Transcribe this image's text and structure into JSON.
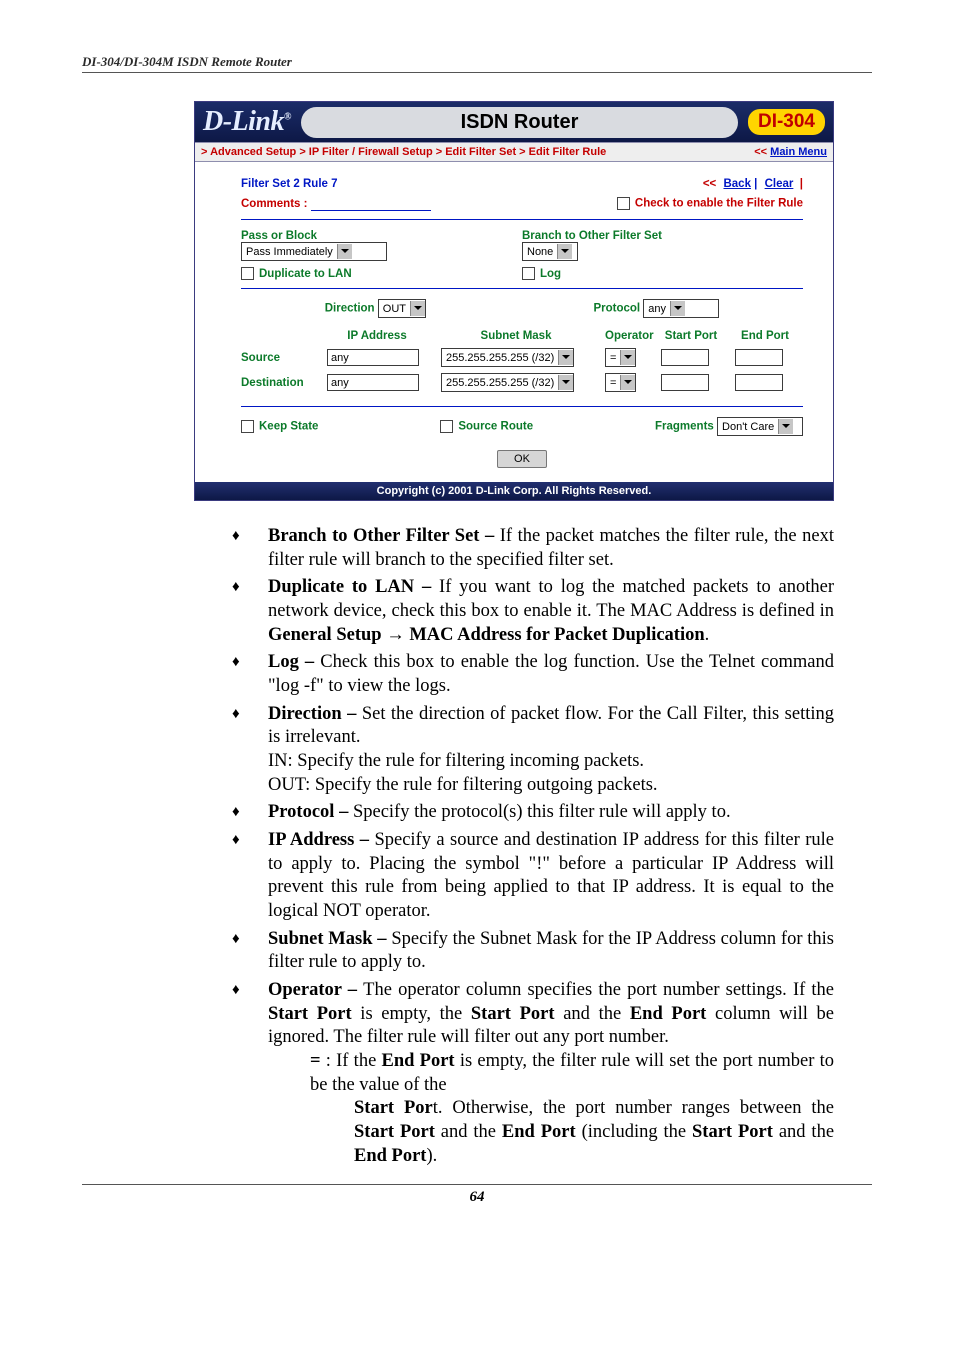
{
  "doc": {
    "header": "DI-304/DI-304M ISDN Remote Router",
    "page_number": "64"
  },
  "shot": {
    "brand": "D-Link",
    "title": "ISDN Router",
    "model": "DI-304",
    "breadcrumb": "> Advanced Setup > IP Filter / Firewall Setup > Edit Filter Set > Edit Filter Rule",
    "main_menu_prefix": "<<",
    "main_menu": "Main Menu",
    "filter_title": "Filter Set 2 Rule 7",
    "back_prefix": "<<",
    "back": "Back",
    "pipe": " | ",
    "clear": "Clear",
    "comments_label": "Comments :",
    "enable_label": "Check to enable the Filter Rule",
    "pass_label": "Pass or Block",
    "pass_value": "Pass Immediately",
    "branch_label": "Branch to Other Filter Set",
    "branch_value": "None",
    "dup_label": "Duplicate to LAN",
    "log_label": "Log",
    "direction_label": "Direction",
    "direction_value": "OUT",
    "protocol_label": "Protocol",
    "protocol_value": "any",
    "col_ip": "IP Address",
    "col_mask": "Subnet Mask",
    "col_op": "Operator",
    "col_start": "Start Port",
    "col_end": "End Port",
    "row_src": "Source",
    "row_dst": "Destination",
    "val_any": "any",
    "val_mask": "255.255.255.255 (/32)",
    "val_op": "=",
    "keep_label": "Keep State",
    "sroute_label": "Source Route",
    "frag_label": "Fragments",
    "frag_value": "Don't Care",
    "ok": "OK",
    "copyright": "Copyright (c) 2001 D-Link Corp. All Rights Reserved."
  },
  "bul": {
    "b1_t": "Branch to Other Filter Set – ",
    "b1_x": "If the packet matches the filter rule, the next filter rule will branch to the specified filter set.",
    "b2_t": "Duplicate to LAN – ",
    "b2_x1": "If you want to log the matched packets to another network device, check this box to enable it. The MAC Address is defined in ",
    "b2_x2": "General Setup",
    "b2_arrow": " → ",
    "b2_x3": "MAC Address for Packet Duplication",
    "b2_x4": ".",
    "b3_t": "Log – ",
    "b3_x": "Check this box to enable the log function. Use the Telnet command \"log -f\" to view the logs.",
    "b4_t": "Direction – ",
    "b4_x": "Set the direction of packet flow. For the Call Filter, this setting is irrelevant.",
    "b4_in": "IN: Specify the rule for filtering incoming packets.",
    "b4_out": "OUT: Specify the rule for filtering outgoing packets.",
    "b5_t": "Protocol – ",
    "b5_x": "Specify the protocol(s) this filter rule will apply to.",
    "b6_t": "IP Address – ",
    "b6_x": "Specify a source and destination IP address for this filter rule to apply to. Placing the symbol \"!\" before a particular IP Address will prevent this rule from being applied to that IP address. It is equal to the logical NOT operator.",
    "b7_t": "Subnet Mask – ",
    "b7_x": "Specify the Subnet Mask for the IP Address column for this filter rule to apply to.",
    "b8_t": "Operator – ",
    "b8_x1": "The operator column specifies the port number settings. If the ",
    "b8_sp": "Start Port",
    "b8_x2": " is empty, the ",
    "b8_x3": " and the ",
    "b8_ep": "End Port",
    "b8_x4": " column will be ignored. The filter rule will filter out any port number.",
    "b8_eq1": "=",
    "b8_eq2": " : If the ",
    "b8_eq3": " is empty, the filter rule will set the port number to be the value of the ",
    "b8_spo": "Start Por",
    "b8_eq4": "t. Otherwise, the port number ranges between the ",
    "b8_eq5": " and the ",
    "b8_eq6": " (including the ",
    "b8_eq7": " and the ",
    "b8_eq8": ")."
  }
}
